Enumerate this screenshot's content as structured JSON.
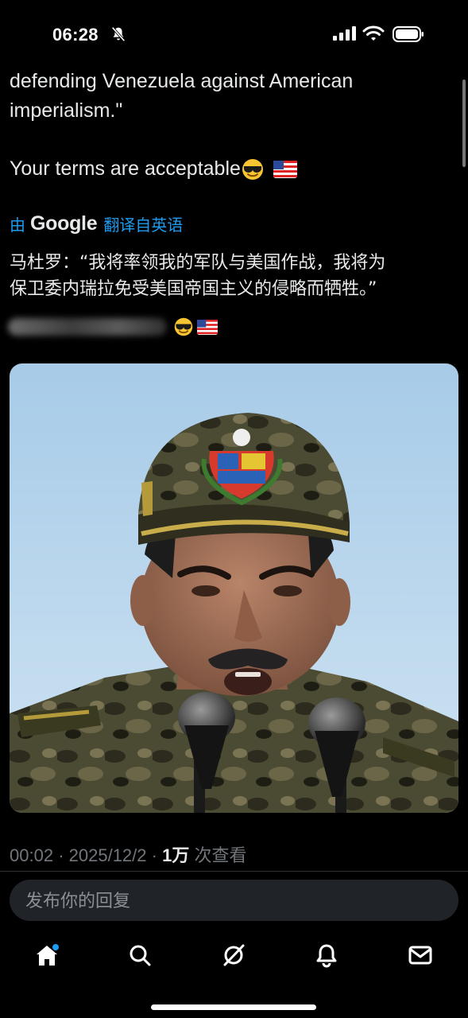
{
  "status_bar": {
    "time": "06:28"
  },
  "tweet": {
    "text_lines": [
      "defending Venezuela against American",
      "imperialism.\""
    ],
    "terms_text": "Your terms are acceptable",
    "terms_emojis": [
      "smiling-face-with-sunglasses",
      "us-flag"
    ]
  },
  "translation": {
    "prefix": "由",
    "brand": "Google",
    "suffix": "翻译自英语",
    "lines": [
      "马杜罗：“我将率领我的军队与美国作战，我将为",
      "保卫委内瑞拉免受美国帝国主义的侵略而牺牲。”"
    ]
  },
  "media": {
    "subject": "man in camouflage military cap speaking at two microphones"
  },
  "meta": {
    "time": "00:02",
    "date": "2025/12/2",
    "views_count": "1万",
    "views_label": "次查看"
  },
  "reply": {
    "placeholder": "发布你的回复"
  },
  "nav": {
    "items": [
      "home",
      "search",
      "grok",
      "notifications",
      "messages"
    ],
    "accent": "#1d9bf0"
  }
}
